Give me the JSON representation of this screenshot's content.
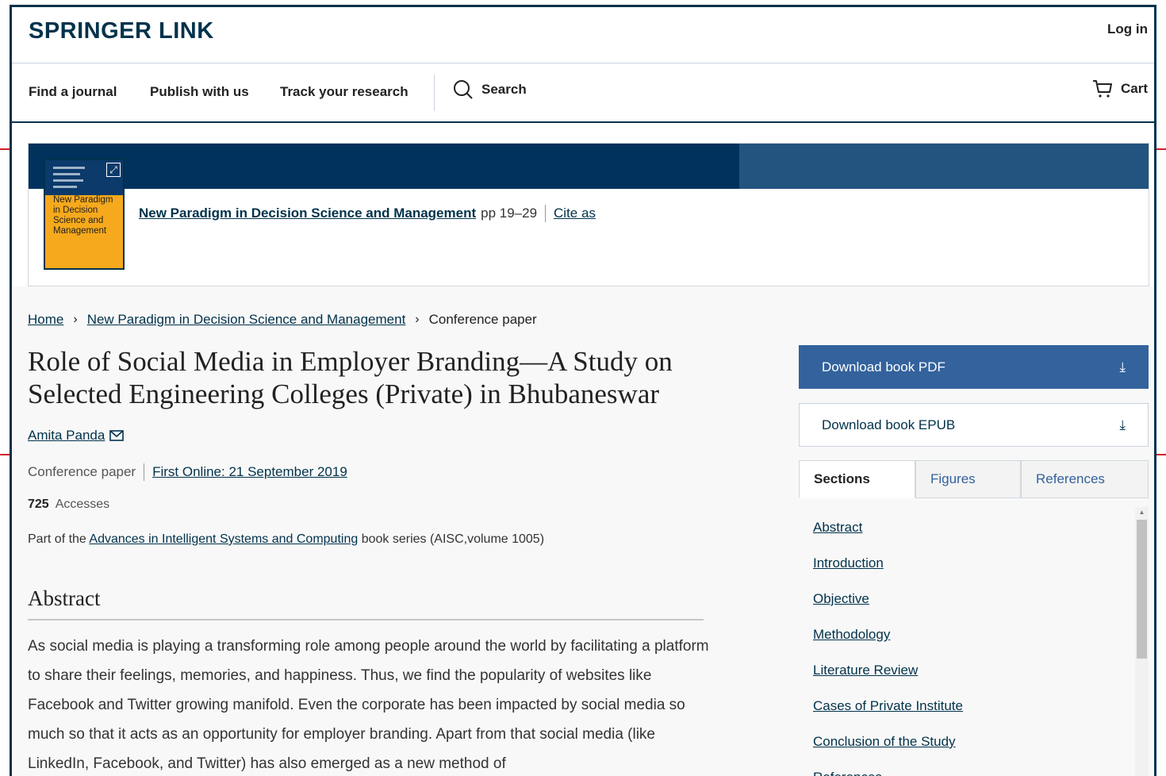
{
  "header": {
    "logo": "SPRINGER LINK",
    "login": "Log in"
  },
  "nav": {
    "items": [
      "Find a journal",
      "Publish with us",
      "Track your research"
    ],
    "search": "Search",
    "cart": "Cart"
  },
  "book": {
    "cover_title": "New Paradigm in Decision Science and Management",
    "title": "New Paradigm in Decision Science and Management",
    "pages": "pp 19–29",
    "cite": "Cite as"
  },
  "breadcrumb": {
    "home": "Home",
    "book": "New Paradigm in Decision Science and Management",
    "current": "Conference paper"
  },
  "paper": {
    "title": "Role of Social Media in Employer Branding—A Study on Selected Engineering Colleges (Private) in Bhubaneswar",
    "author": "Amita Panda",
    "type": "Conference paper",
    "first_online": "First Online: 21 September 2019",
    "accesses_count": "725",
    "accesses_label": "Accesses",
    "part_of_prefix": "Part of the",
    "series": "Advances in Intelligent Systems and Computing",
    "part_of_suffix": "book series (AISC,volume 1005)"
  },
  "abstract": {
    "heading": "Abstract",
    "text": "As social media is playing a transforming role among people around the world by facilitating a platform to share their feelings, memories, and happiness. Thus, we find the popularity of websites like Facebook and Twitter growing manifold. Even the corporate has been impacted by social media so much so that it acts as an opportunity for employer branding. Apart from that social media (like LinkedIn, Facebook, and Twitter) has also emerged as a new method of"
  },
  "sidebar": {
    "download_pdf": "Download book PDF",
    "download_epub": "Download book EPUB",
    "tabs": [
      "Sections",
      "Figures",
      "References"
    ],
    "sections": [
      "Abstract",
      "Introduction",
      "Objective",
      "Methodology",
      "Literature Review",
      "Cases of Private Institute",
      "Conclusion of the Study",
      "References"
    ]
  },
  "colors": {
    "brand": "#01324b",
    "download_pdf_bg": "#33629d",
    "banner_dark": "#01325d",
    "banner_light": "#23537f",
    "cover": "#f6a91c"
  }
}
